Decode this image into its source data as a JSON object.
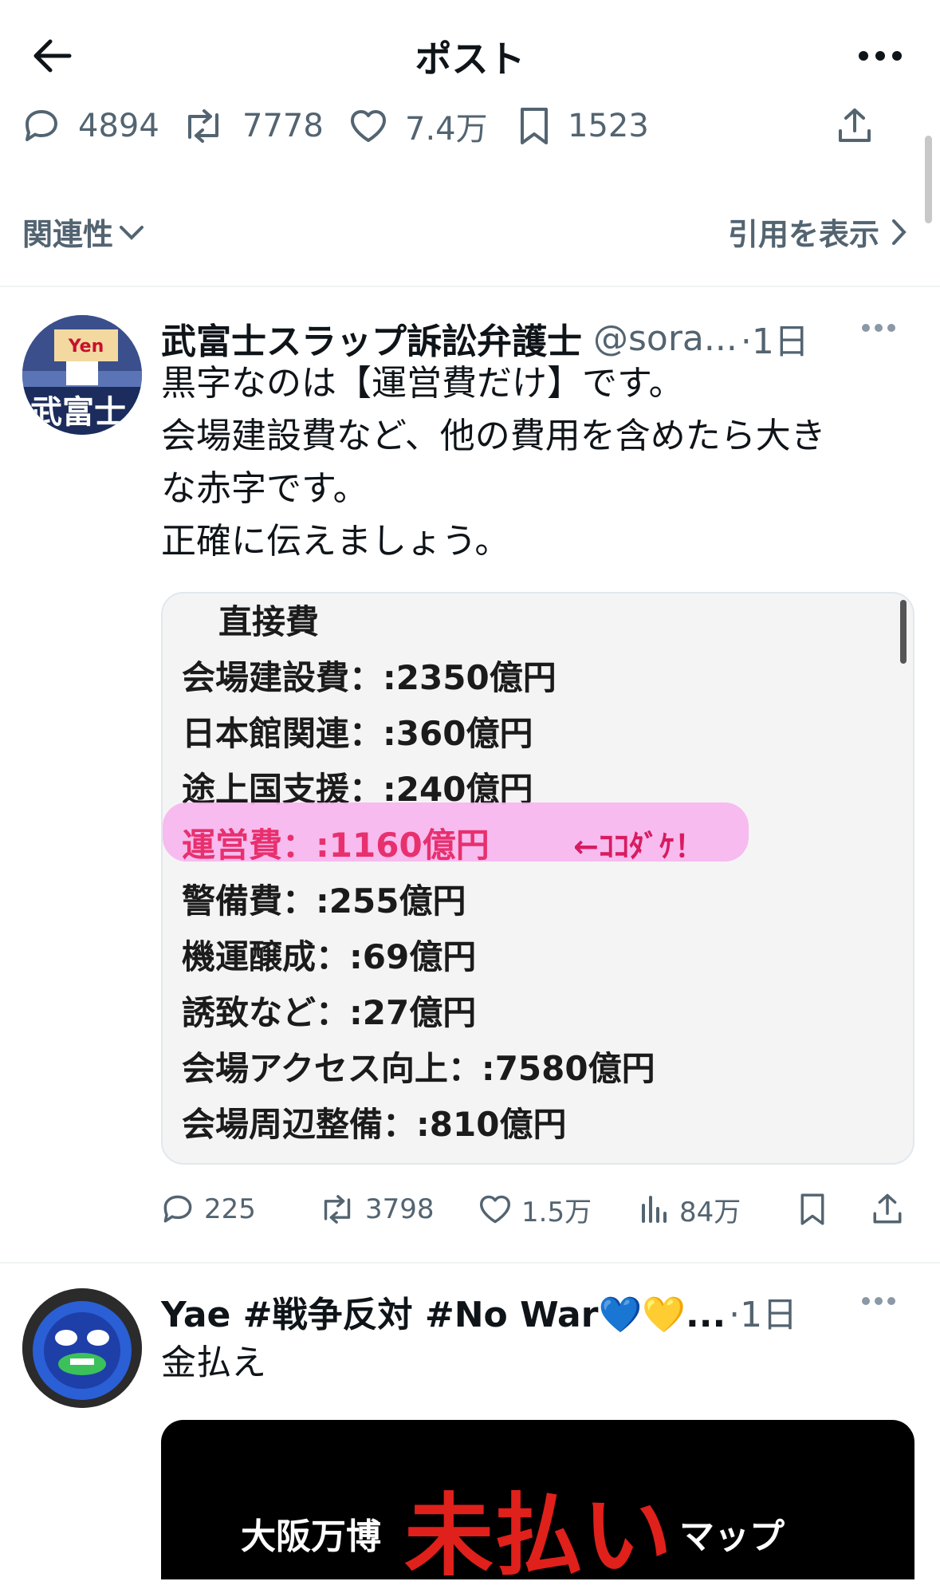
{
  "header": {
    "title": "ポスト"
  },
  "stats": {
    "replies": "4894",
    "reposts": "7778",
    "likes": "7.4万",
    "bookmarks": "1523"
  },
  "sort": {
    "label": "関連性",
    "quotes_link": "引用を表示"
  },
  "tweet1": {
    "name": "武富士スラップ訴訟弁護士",
    "handle": "@sora...",
    "time": "·1日",
    "text": [
      "黒字なのは【運営費だけ】です。",
      "会場建設費など、他の費用を含めたら大き",
      "な赤字です。",
      "正確に伝えましょう。"
    ],
    "media_lines": [
      "直接費",
      "会場建設費：:2350億円",
      "日本館関連：:360億円",
      "途上国支援：:240億円",
      "運営費：:1160億円",
      "警備費：:255億円",
      "機運醸成：:69億円",
      "誘致など：:27億円",
      "会場アクセス向上：:7580億円",
      "会場周辺整備：:810億円"
    ],
    "media_note": "←ｺｺﾀﾞｹ！",
    "actions": {
      "replies": "225",
      "reposts": "3798",
      "likes": "1.5万",
      "views": "84万"
    }
  },
  "tweet2": {
    "name": "Yae #戦争反対 #No War💙💛...",
    "time": "·1日",
    "text": "金払え",
    "banner": {
      "left": "大阪万博",
      "center": "未払い",
      "right": "マップ"
    }
  },
  "colors": {
    "accent": "#1d9bf0",
    "muted": "#536471",
    "highlight": "#f7b5ee",
    "red": "#e0201b"
  }
}
